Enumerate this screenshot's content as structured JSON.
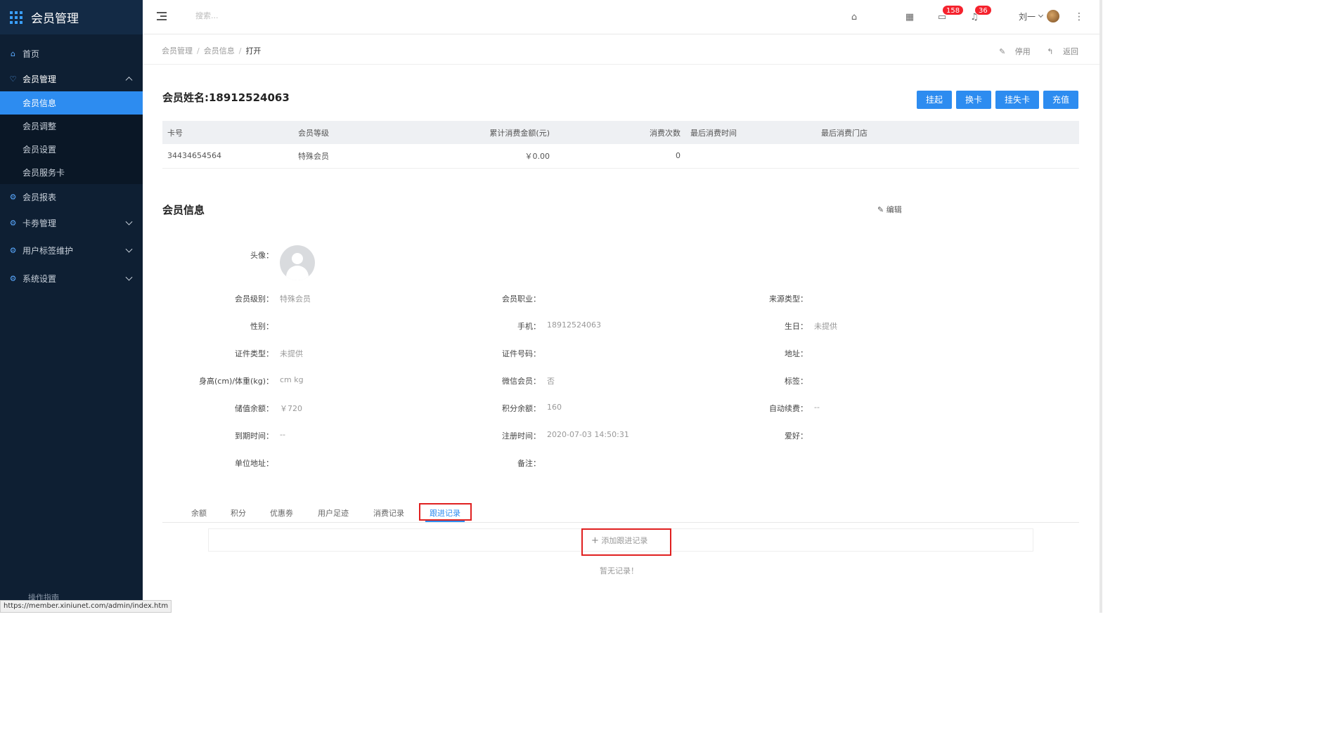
{
  "app": {
    "title": "会员管理"
  },
  "sidebar": {
    "items": [
      {
        "label": "首页",
        "icon": "home-icon"
      },
      {
        "label": "会员管理",
        "icon": "member-icon",
        "open": true,
        "children": [
          {
            "label": "会员信息",
            "active": true
          },
          {
            "label": "会员调整"
          },
          {
            "label": "会员设置"
          },
          {
            "label": "会员服务卡"
          }
        ]
      },
      {
        "label": "会员报表",
        "icon": "gear-icon"
      },
      {
        "label": "卡劵管理",
        "icon": "gear-icon"
      },
      {
        "label": "用户标签维护",
        "icon": "gear-icon"
      },
      {
        "label": "系统设置",
        "icon": "gear-icon"
      }
    ],
    "footer": "操作指南"
  },
  "header": {
    "search_placeholder": "搜索...",
    "mail_badge": "158",
    "bell_badge": "36",
    "user_name": "刘一"
  },
  "breadcrumb": {
    "items": [
      "会员管理",
      "会员信息",
      "打开"
    ],
    "disable_label": "停用",
    "back_label": "返回"
  },
  "member": {
    "name_title": "会员姓名:18912524063",
    "buttons": [
      "挂起",
      "换卡",
      "挂失卡",
      "充值"
    ]
  },
  "card_table": {
    "headers": [
      "卡号",
      "会员等级",
      "累计消费金额(元)",
      "消费次数",
      "最后消费时间",
      "最后消费门店"
    ],
    "rows": [
      [
        "34434654564",
        "特殊会员",
        "￥0.00",
        "0",
        "",
        ""
      ]
    ]
  },
  "info": {
    "section_title": "会员信息",
    "edit_label": "编辑",
    "avatar_label": "头像：",
    "fields": [
      {
        "label": "会员级别：",
        "value": "特殊会员"
      },
      {
        "label": "会员职业：",
        "value": ""
      },
      {
        "label": "来源类型：",
        "value": ""
      },
      {
        "label": "性别：",
        "value": ""
      },
      {
        "label": "手机：",
        "value": "18912524063"
      },
      {
        "label": "生日：",
        "value": "未提供"
      },
      {
        "label": "证件类型：",
        "value": "未提供"
      },
      {
        "label": "证件号码：",
        "value": ""
      },
      {
        "label": "地址：",
        "value": ""
      },
      {
        "label": "身高(cm)/体重(kg)：",
        "value": "cm kg"
      },
      {
        "label": "微信会员：",
        "value": "否"
      },
      {
        "label": "标签：",
        "value": ""
      },
      {
        "label": "储值余额：",
        "value": "￥720"
      },
      {
        "label": "积分余额：",
        "value": "160"
      },
      {
        "label": "自动续费：",
        "value": "--"
      },
      {
        "label": "到期时间：",
        "value": "--"
      },
      {
        "label": "注册时间：",
        "value": "2020-07-03 14:50:31"
      },
      {
        "label": "爱好：",
        "value": ""
      },
      {
        "label": "单位地址：",
        "value": ""
      },
      {
        "label": "备注：",
        "value": ""
      }
    ]
  },
  "tabs": {
    "items": [
      "余额",
      "积分",
      "优惠劵",
      "用户足迹",
      "消费记录",
      "跟进记录"
    ],
    "active_index": 5
  },
  "followup": {
    "add_label": "添加跟进记录",
    "empty_text": "暂无记录！"
  },
  "statusbar": {
    "url": "https://member.xiniunet.com/admin/index.htm"
  },
  "colors": {
    "sidebar_bg": "#0e1f33",
    "accent": "#2d8cf0",
    "badge": "#f5222d",
    "highlight_box": "#e02020"
  }
}
